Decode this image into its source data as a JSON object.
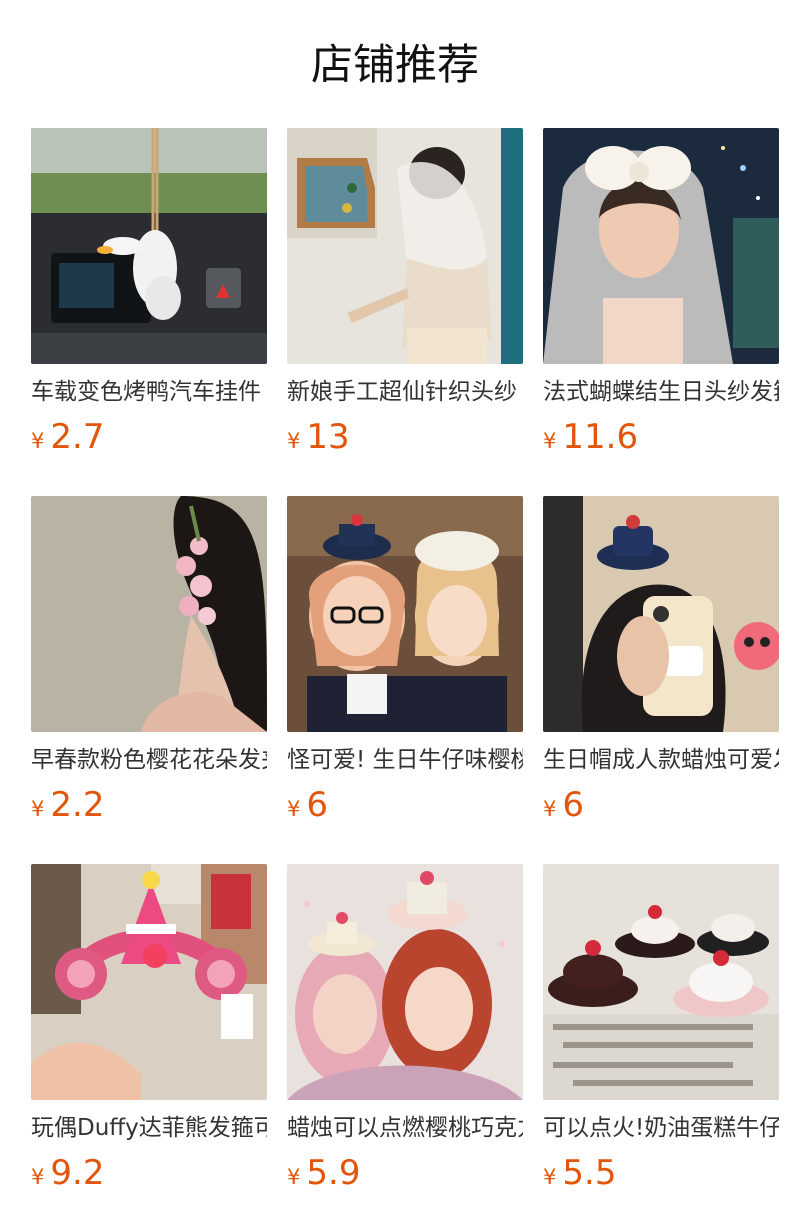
{
  "header": {
    "title": "店铺推荐"
  },
  "products": [
    {
      "name": "车载变色烤鸭汽车挂件",
      "currency": "¥",
      "price": "2.7",
      "image_icon": "duck-car-pendant-image"
    },
    {
      "name": "新娘手工超仙针织头纱",
      "currency": "¥",
      "price": "13",
      "image_icon": "knit-veil-image"
    },
    {
      "name": "法式蝴蝶结生日头纱发箍",
      "currency": "¥",
      "price": "11.6",
      "image_icon": "bow-veil-image"
    },
    {
      "name": "早春款粉色樱花花朵发夹",
      "currency": "¥",
      "price": "2.2",
      "image_icon": "sakura-hairpin-image"
    },
    {
      "name": "怪可爱! 生日牛仔味樱桃帽",
      "currency": "¥",
      "price": "6",
      "image_icon": "cake-hat-friends-image"
    },
    {
      "name": "生日帽成人款蜡烛可爱发夹",
      "currency": "¥",
      "price": "6",
      "image_icon": "candle-hat-selfie-image"
    },
    {
      "name": "玩偶Duffy达菲熊发箍可爱",
      "currency": "¥",
      "price": "9.2",
      "image_icon": "duffy-headband-image"
    },
    {
      "name": "蜡烛可以点燃樱桃巧克力帽",
      "currency": "¥",
      "price": "5.9",
      "image_icon": "cherry-hats-pair-image"
    },
    {
      "name": "可以点火!奶油蛋糕牛仔帽",
      "currency": "¥",
      "price": "5.5",
      "image_icon": "cream-cake-hats-image"
    }
  ]
}
